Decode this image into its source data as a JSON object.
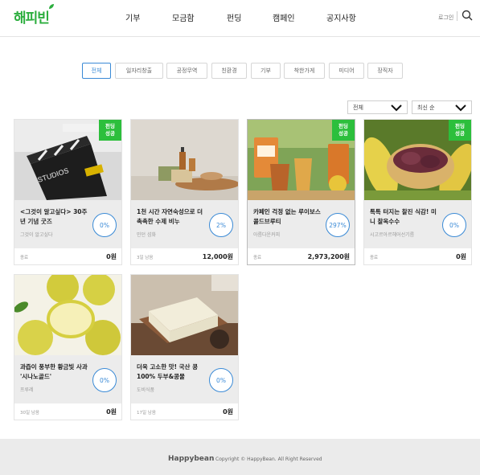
{
  "header": {
    "logo": "해피빈",
    "nav": [
      "기부",
      "모금함",
      "펀딩",
      "캠페인",
      "공지사항"
    ],
    "login": "로그인"
  },
  "filters": {
    "categories": [
      "전체",
      "일자리창출",
      "공정무역",
      "친환경",
      "기부",
      "착한가게",
      "미디어",
      "장직자"
    ],
    "active_index": 0,
    "sort_left": "전체",
    "sort_right": "최신 순"
  },
  "cards": [
    {
      "title": "<그것이 알고싶다> 30주년 기념 굿즈",
      "org": "그것이 알고싶다",
      "pct": "0%",
      "left": "종료",
      "amount": "0원",
      "badge": "펀딩\n성공"
    },
    {
      "title": "1천 시간 자연숙성으로 더 촉촉한 수제 비누",
      "org": "민던 섬화",
      "pct": "2%",
      "left": "3일 남음",
      "amount": "12,000원",
      "badge": ""
    },
    {
      "title": "카페인 걱정 없는 루이보스 콜드브루티",
      "org": "아름다운커피",
      "pct": "297%",
      "left": "종료",
      "amount": "2,973,200원",
      "badge": "펀딩\n성공"
    },
    {
      "title": "톡톡 터지는 찰진 식감! 미니 찰옥수수",
      "org": "시고르아르헤어선기름",
      "pct": "0%",
      "left": "종료",
      "amount": "0원",
      "badge": "펀딩\n성공"
    },
    {
      "title": "과즙이 풍부한 황금빛 사과 '시나노골드'",
      "org": "프루레",
      "pct": "0%",
      "left": "30일 남음",
      "amount": "0원",
      "badge": ""
    },
    {
      "title": "더욱 고소한 맛! 국산 콩 100% 두부&콩물",
      "org": "도비식품",
      "pct": "0%",
      "left": "17일 남음",
      "amount": "0원",
      "badge": ""
    }
  ],
  "footer": {
    "logo": "Happybean",
    "copyright": "Copyright © HappyBean. All Right Reserved"
  },
  "colors": {
    "brand_green": "#2cae3e",
    "badge_green": "#2cbf3c",
    "accent_blue": "#3a8ad6"
  }
}
